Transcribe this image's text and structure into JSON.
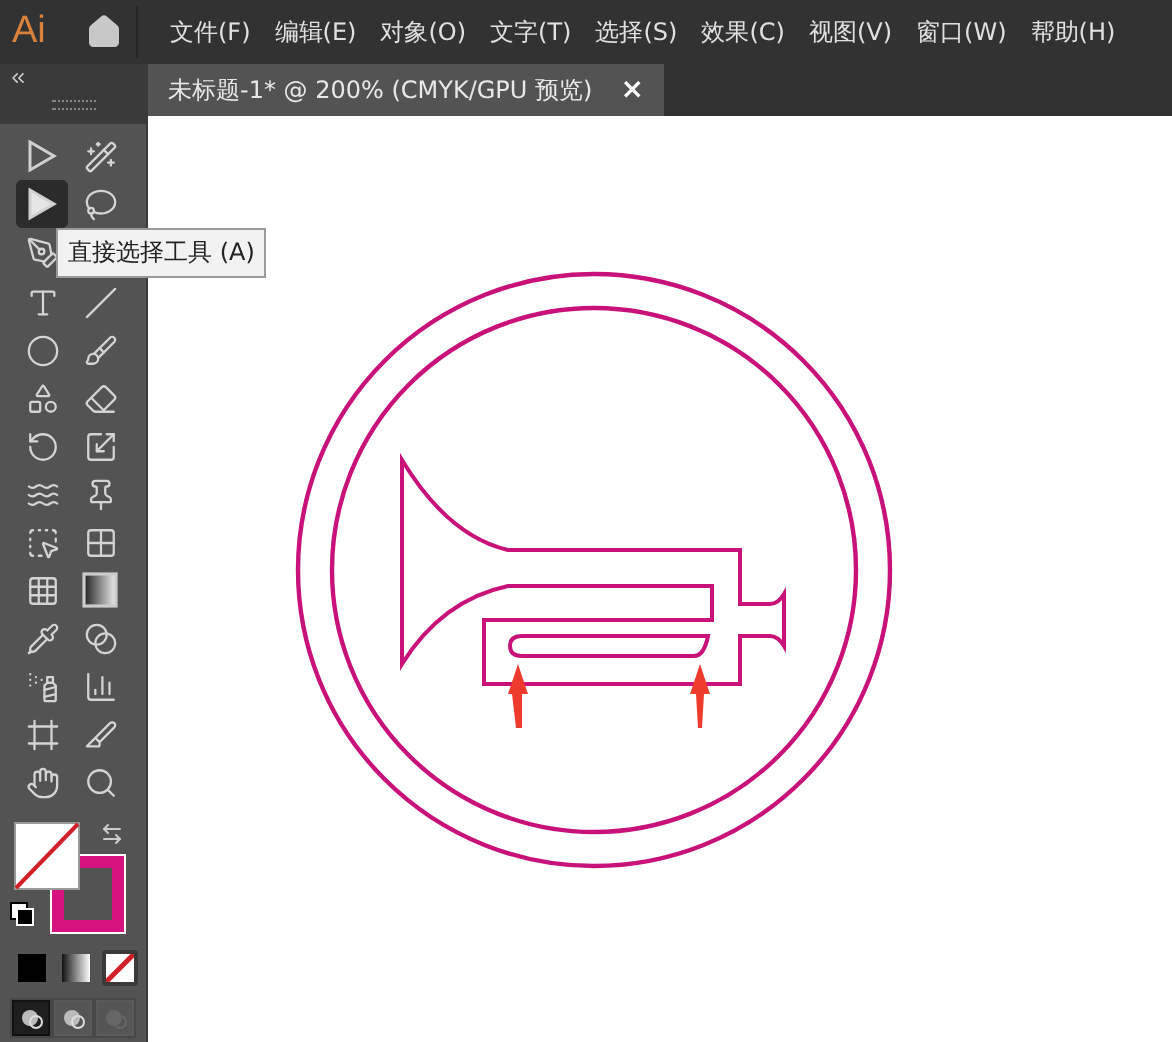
{
  "app": {
    "logo": "Ai"
  },
  "menu": [
    "文件(F)",
    "编辑(E)",
    "对象(O)",
    "文字(T)",
    "选择(S)",
    "效果(C)",
    "视图(V)",
    "窗口(W)",
    "帮助(H)"
  ],
  "document_tab": {
    "title": "未标题-1* @ 200% (CMYK/GPU 预览)",
    "close": "×",
    "selected": true
  },
  "tools": [
    {
      "kind": "select",
      "selected": false
    },
    {
      "kind": "magic-wand",
      "selected": false
    },
    {
      "kind": "direct-select",
      "selected": true
    },
    {
      "kind": "lasso",
      "selected": false
    },
    {
      "kind": "pen",
      "selected": false
    },
    {
      "kind": "type",
      "selected": false
    },
    {
      "kind": "line",
      "selected": false
    },
    {
      "kind": "ellipse",
      "selected": false
    },
    {
      "kind": "paintbrush",
      "selected": false
    },
    {
      "kind": "shaper",
      "selected": false
    },
    {
      "kind": "eraser",
      "selected": false
    },
    {
      "kind": "rotate",
      "selected": false
    },
    {
      "kind": "scale",
      "selected": false
    },
    {
      "kind": "warp",
      "selected": false
    },
    {
      "kind": "pin",
      "selected": false
    },
    {
      "kind": "free-transform",
      "selected": false
    },
    {
      "kind": "perspective",
      "selected": false
    },
    {
      "kind": "mesh",
      "selected": false
    },
    {
      "kind": "gradient",
      "selected": false
    },
    {
      "kind": "eyedropper",
      "selected": false
    },
    {
      "kind": "blend",
      "selected": false
    },
    {
      "kind": "symbol-sprayer",
      "selected": false
    },
    {
      "kind": "graph",
      "selected": false
    },
    {
      "kind": "artboard",
      "selected": false
    },
    {
      "kind": "slice",
      "selected": false
    },
    {
      "kind": "hand",
      "selected": false
    },
    {
      "kind": "zoom",
      "selected": false
    }
  ],
  "tooltip": "直接选择工具 (A)",
  "color_modes": [
    {
      "kind": "color",
      "selected": false
    },
    {
      "kind": "gradient",
      "selected": false
    },
    {
      "kind": "none",
      "selected": true
    }
  ],
  "draw_modes": [
    {
      "selected": true
    },
    {
      "selected": false
    },
    {
      "selected": false
    }
  ]
}
